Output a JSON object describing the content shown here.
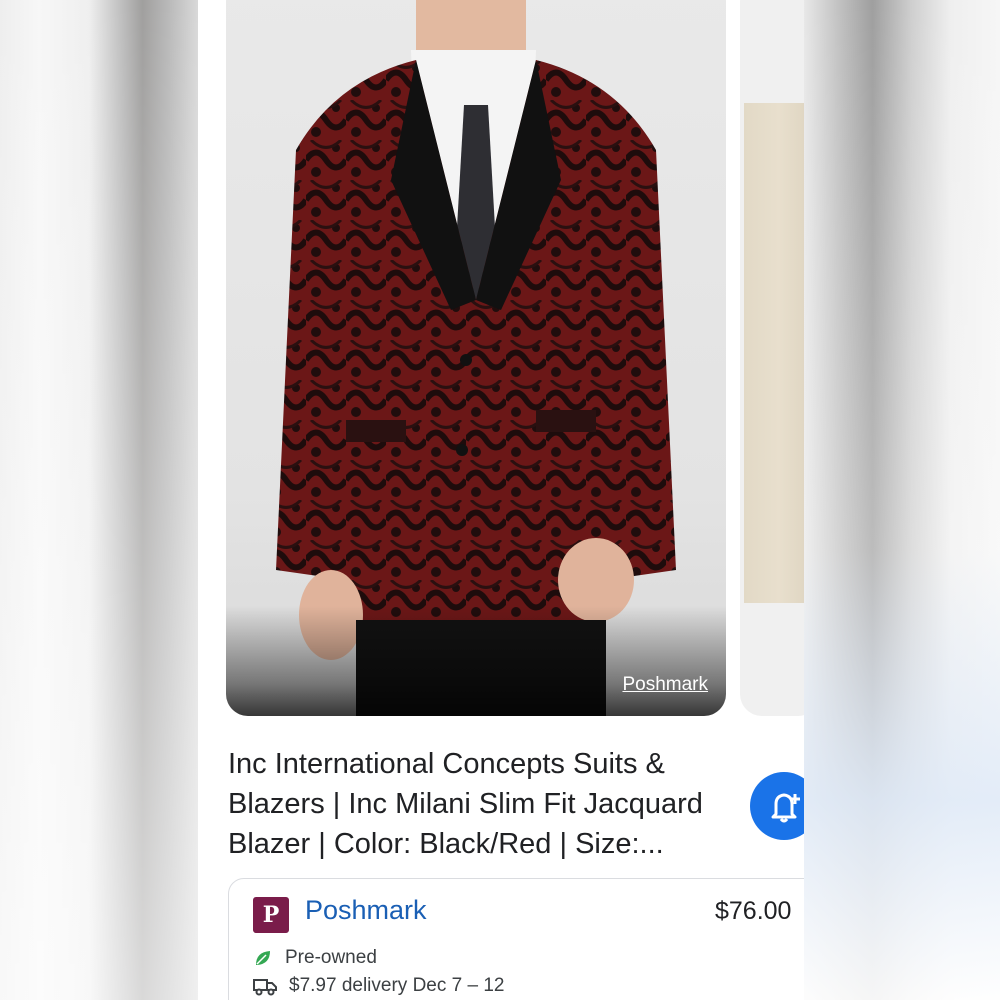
{
  "product": {
    "image_source": "Poshmark",
    "title": "Inc International Concepts Suits & Blazers | Inc Milani Slim Fit Jacquard Blazer | Color: Black/Red | Size:..."
  },
  "offer": {
    "merchant_logo_letter": "P",
    "merchant": "Poshmark",
    "price": "$76.00",
    "condition": "Pre-owned",
    "delivery": "$7.97 delivery Dec 7 – 12"
  },
  "icons": {
    "alert": "bell-plus-icon",
    "condition": "leaf-icon",
    "delivery": "truck-icon"
  },
  "colors": {
    "accent": "#1a73e8",
    "merchant_link": "#1a5fb4",
    "merchant_logo_bg": "#7a1c4a",
    "leaf": "#34a853"
  }
}
